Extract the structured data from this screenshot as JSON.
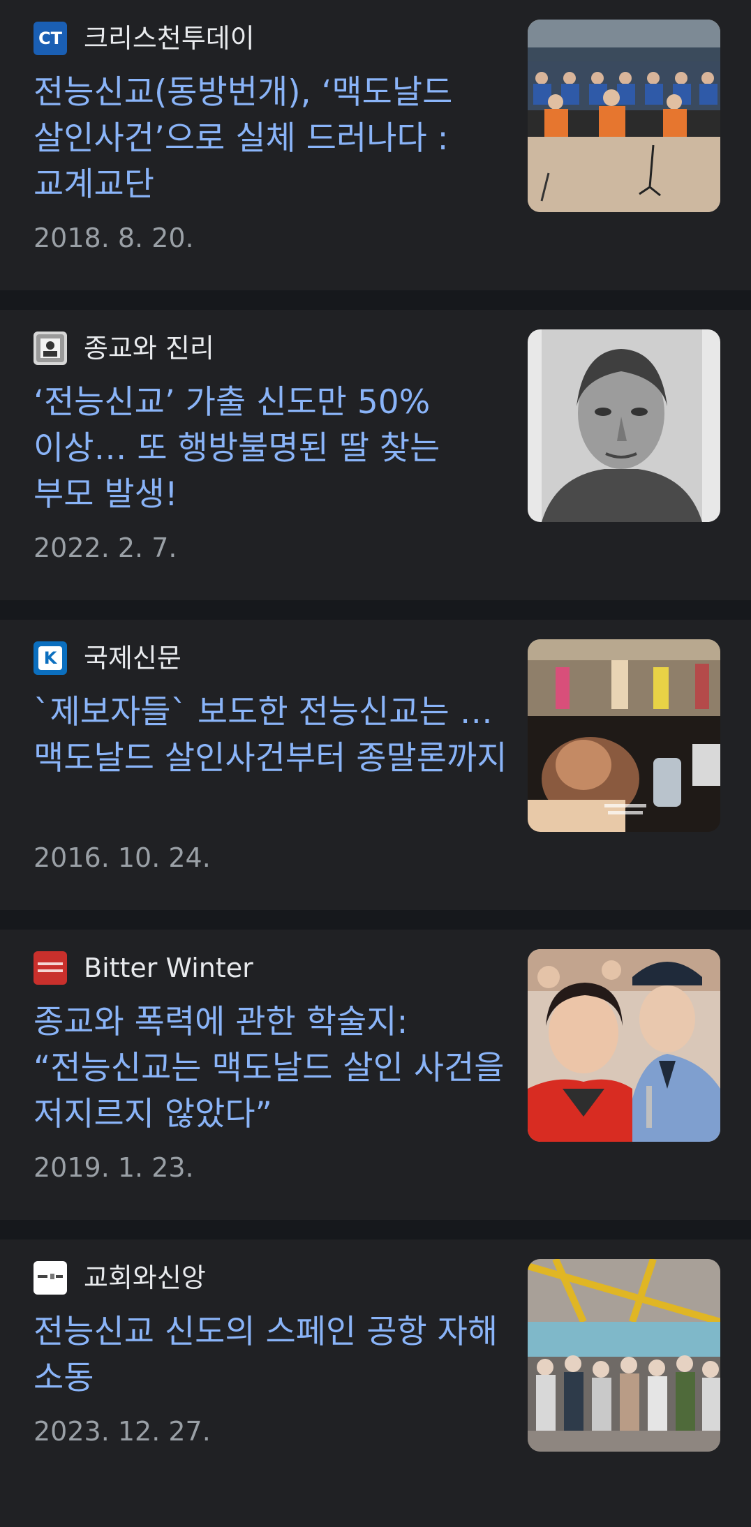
{
  "articles": [
    {
      "source": "크리스천투데이",
      "logo_icon": "christian-today-logo",
      "logo_text": "CT",
      "headline": "전능신교(동방번개), ‘맥도날드 살인사건’으로 실체 드러나다 : 교계교단",
      "date": "2018. 8. 20.",
      "thumbnail": "courtroom-photo"
    },
    {
      "source": "종교와 진리",
      "logo_icon": "religion-truth-logo",
      "headline": "‘전능신교’ 가출 신도만 50% 이상… 또 행방불명된 딸 찾는 부모 발생!",
      "date": "2022. 2. 7.",
      "thumbnail": "missing-person-portrait"
    },
    {
      "source": "국제신문",
      "logo_icon": "kookje-logo",
      "logo_text": "K",
      "headline": "`제보자들` 보도한 전능신교는 … 맥도날드 살인사건부터 종말론까지",
      "date": "2016. 10. 24.",
      "thumbnail": "tv-report-collage"
    },
    {
      "source": "Bitter Winter",
      "logo_icon": "bitter-winter-logo",
      "headline": "종교와 폭력에 관한 학술지: “전능신교는 맥도날드 살인 사건을 저지르지 않았다”",
      "date": "2019. 1. 23.",
      "thumbnail": "trial-woman-police-photo"
    },
    {
      "source": "교회와신앙",
      "logo_icon": "church-faith-logo",
      "headline": "전능신교 신도의 스페인 공항 자해 소동",
      "date": "2023. 12. 27.",
      "thumbnail": "airport-protest-photo"
    }
  ],
  "colors": {
    "background": "#16181c",
    "card": "#202124",
    "headline": "#8ab4f8",
    "source": "#e8eaed",
    "date": "#9aa0a6"
  }
}
